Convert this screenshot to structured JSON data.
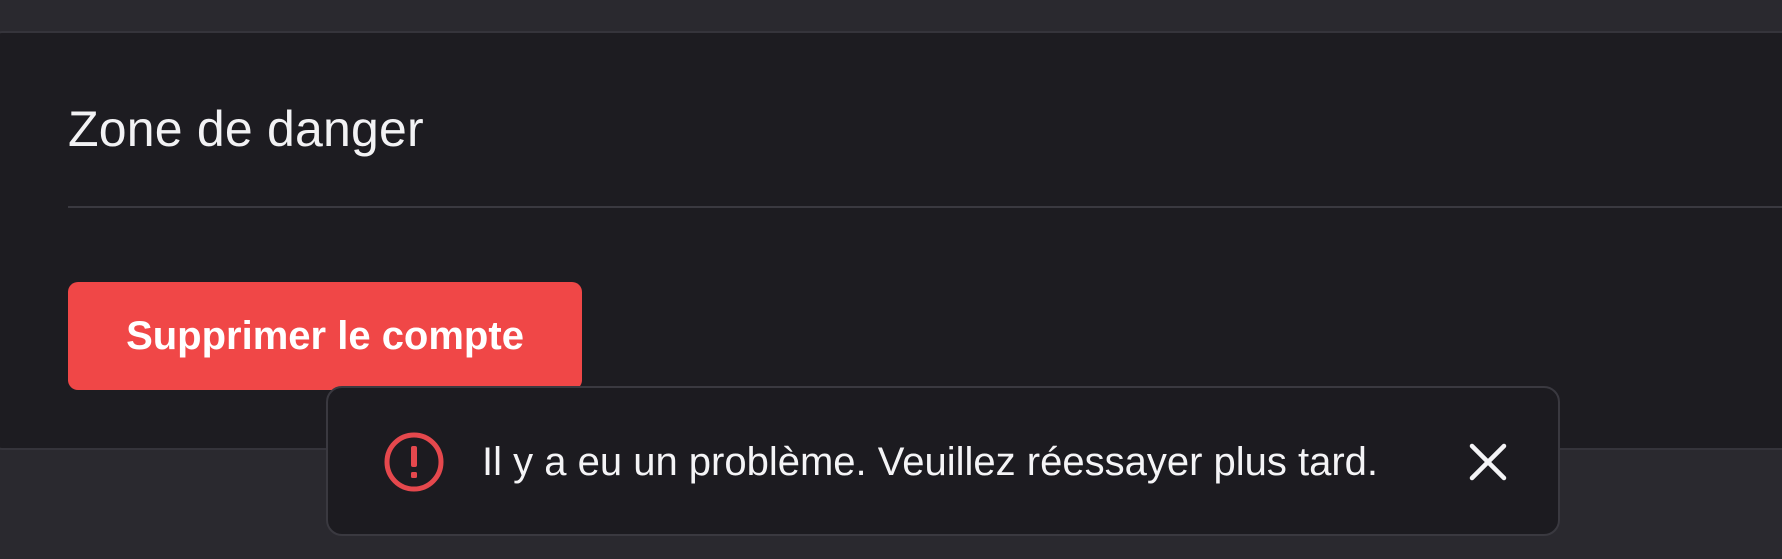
{
  "danger_zone": {
    "title": "Zone de danger",
    "delete_button_label": "Supprimer le compte"
  },
  "toast": {
    "message": "Il y a eu un problème. Veuillez réessayer plus tard.",
    "icon": "error-circle-icon",
    "close_icon": "close-icon"
  },
  "colors": {
    "background": "#2a292f",
    "card_background": "#1d1c21",
    "danger": "#f04747",
    "toast_background": "#1c1b20",
    "error_icon": "#e5484d",
    "text": "#f4f4f6"
  }
}
